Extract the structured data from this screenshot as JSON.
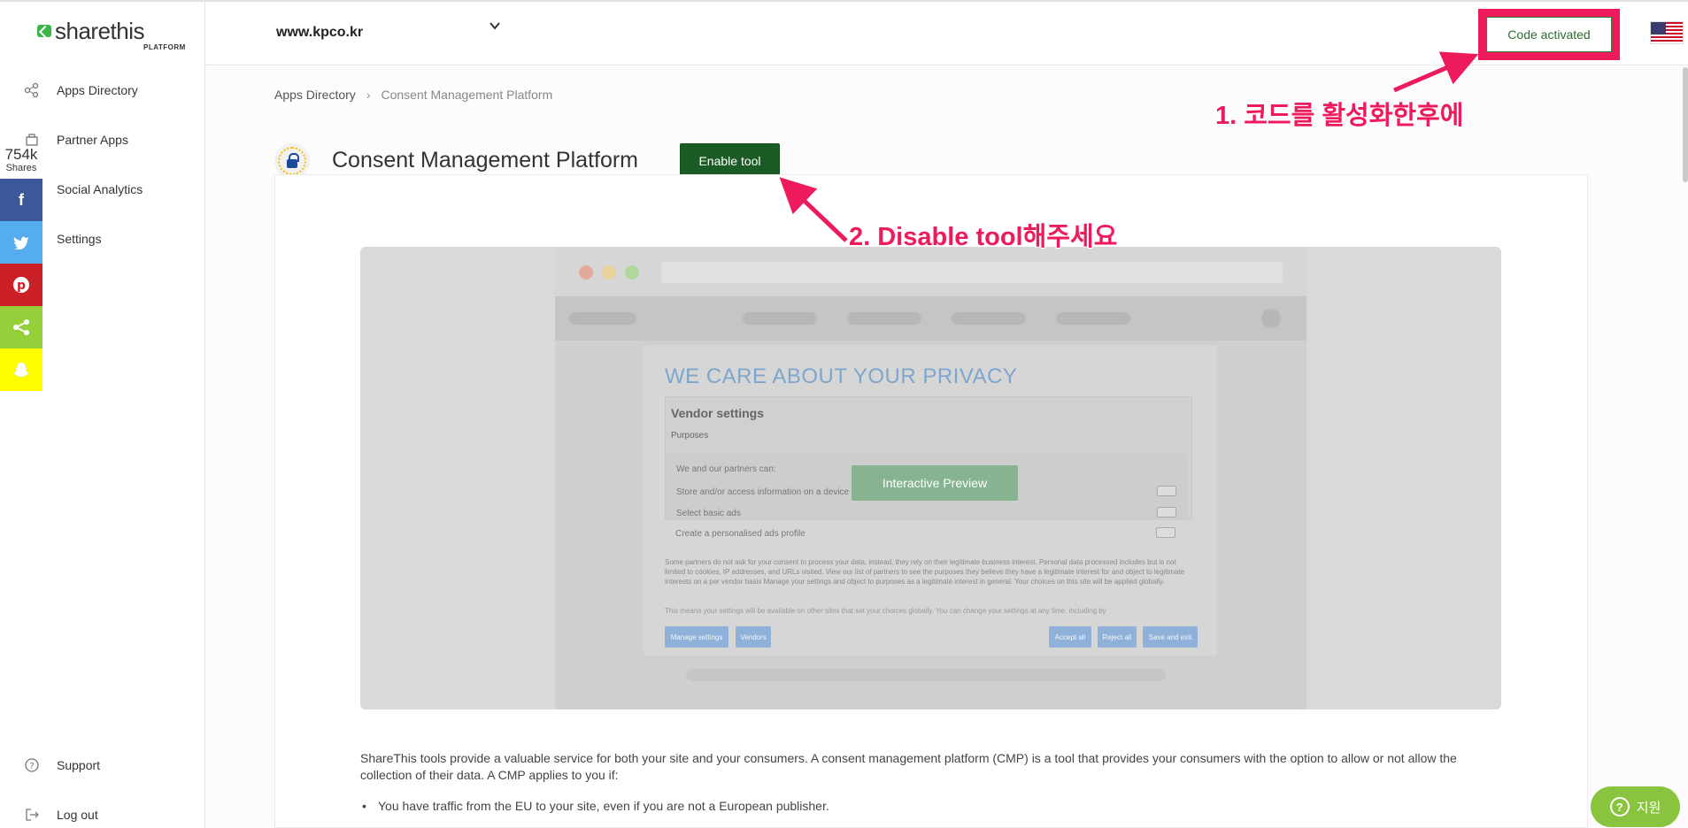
{
  "logo": {
    "word": "sharethis",
    "sub": "PLATFORM"
  },
  "sidebar": {
    "items": [
      {
        "label": "Apps Directory",
        "icon": "apps-icon"
      },
      {
        "label": "Partner Apps",
        "icon": "partner-icon"
      },
      {
        "label": "Social Analytics",
        "icon": "analytics-icon"
      },
      {
        "label": "Settings",
        "icon": "settings-icon"
      }
    ],
    "support": "Support",
    "logout": "Log out"
  },
  "share": {
    "count": "754k",
    "label": "Shares"
  },
  "header": {
    "domain": "www.kpco.kr",
    "code_button": "Code activated"
  },
  "breadcrumb": {
    "root": "Apps Directory",
    "sep": "›",
    "current": "Consent Management Platform"
  },
  "tool": {
    "title": "Consent Management Platform",
    "enable": "Enable tool"
  },
  "preview": {
    "heading": "WE CARE ABOUT YOUR PRIVACY",
    "vendor_settings": "Vendor settings",
    "purposes": "Purposes",
    "partners_can": "We and our partners can:",
    "rows": [
      "Store and/or access information on a device",
      "Select basic ads",
      "Create a personalised ads profile"
    ],
    "para": "Some partners do not ask for your consent to process your data, instead, they rely on their legitimate business interest. Personal data processed includes but is not limited to cookies, IP addresses, and URLs visited. View our list of partners to see the purposes they believe they have a legitimate interest for and object to legitimate interests on a per vendor basis Manage your settings and object to purposes as a legitimate interest in general. Your choices on this site will be applied globally.",
    "para2": "This means your settings will be available on other sites that set your choices globally. You can change your settings at any time, including by",
    "buttons": {
      "manage": "Manage settings",
      "vendors": "Vendors",
      "accept": "Accept all",
      "reject": "Reject all",
      "save": "Save and exit"
    },
    "interactive": "Interactive Preview"
  },
  "description": "ShareThis tools provide a valuable service for both your site and your consumers. A consent management platform (CMP) is a tool that provides your consumers with the option to allow or not allow the collection of their data. A CMP applies to you if:",
  "bullets": [
    "You have traffic from the EU to your site, even if you are not a European publisher."
  ],
  "annotations": {
    "step1": "1. 코드를 활성화한후에",
    "step2": "2. Disable tool해주세요"
  },
  "help": {
    "label": "지원"
  },
  "colors": {
    "annotation": "#ee1b5c",
    "enable": "#1a5b26",
    "help": "#8ac43f"
  }
}
